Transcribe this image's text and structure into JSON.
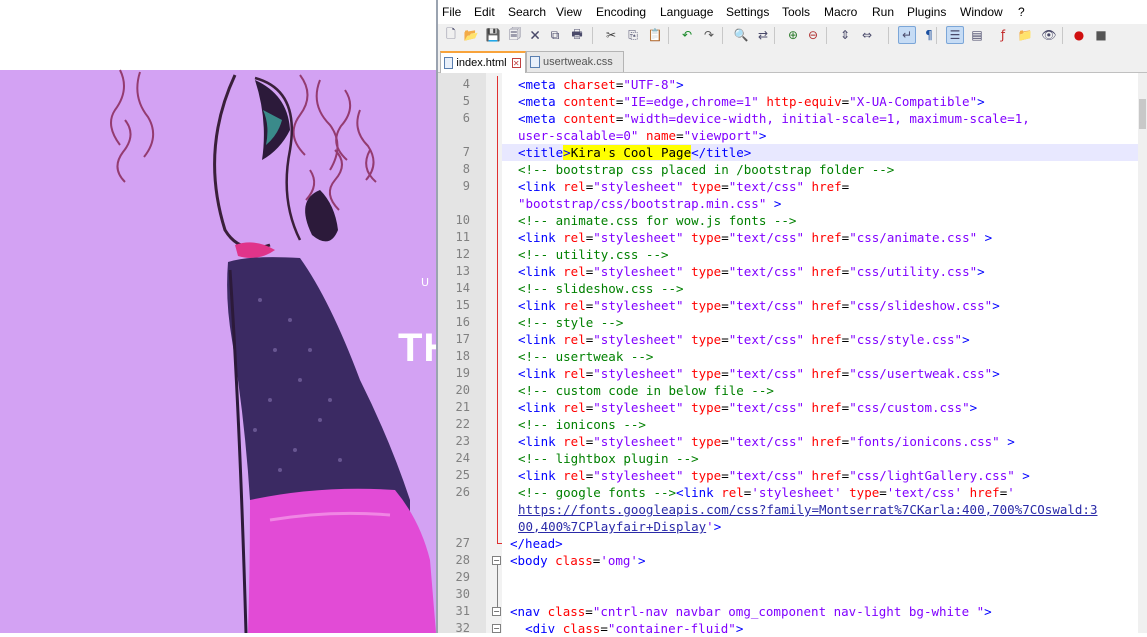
{
  "preview": {
    "hero_small": "U",
    "hero_big": "TH"
  },
  "menu": [
    "File",
    "Edit",
    "Search",
    "View",
    "Encoding",
    "Language",
    "Settings",
    "Tools",
    "Macro",
    "Run",
    "Plugins",
    "Window",
    "?"
  ],
  "toolbar_icons": [
    "new-file-icon",
    "open-file-icon",
    "save-icon",
    "save-all-icon",
    "close-icon",
    "close-all-icon",
    "print-icon",
    "cut-icon",
    "copy-icon",
    "paste-icon",
    "undo-icon",
    "redo-icon",
    "find-icon",
    "replace-icon",
    "zoom-in-icon",
    "zoom-out-icon",
    "sync-vertical-icon",
    "sync-horizontal-icon",
    "word-wrap-icon",
    "show-all-chars-icon",
    "indent-guide-icon",
    "doc-map-icon",
    "function-list-icon",
    "folder-workspace-icon",
    "monitor-icon",
    "record-macro-icon",
    "stop-record-icon"
  ],
  "tabs": [
    {
      "label": "index.html",
      "active": true
    },
    {
      "label": "usertweak.css",
      "active": false
    }
  ],
  "colors": {
    "accent_tab": "#f8a33b",
    "tag": "#0000ff",
    "attribute": "#ff0000",
    "value": "#8000ff",
    "comment": "#008000",
    "highlight": "#ffff00"
  },
  "code": {
    "lines": [
      {
        "n": "4",
        "segs": [
          [
            "tag",
            "<meta "
          ],
          [
            "attr",
            "charset"
          ],
          [
            "txt",
            "="
          ],
          [
            "val",
            "\"UTF-8\""
          ],
          [
            "tag",
            ">"
          ]
        ]
      },
      {
        "n": "5",
        "segs": [
          [
            "tag",
            "<meta "
          ],
          [
            "attr",
            "content"
          ],
          [
            "txt",
            "="
          ],
          [
            "val",
            "\"IE=edge,chrome=1\""
          ],
          [
            "txt",
            " "
          ],
          [
            "attr",
            "http-equiv"
          ],
          [
            "txt",
            "="
          ],
          [
            "val",
            "\"X-UA-Compatible\""
          ],
          [
            "tag",
            ">"
          ]
        ]
      },
      {
        "n": "6",
        "segs": [
          [
            "tag",
            "<meta "
          ],
          [
            "attr",
            "content"
          ],
          [
            "txt",
            "="
          ],
          [
            "val",
            "\"width=device-width, initial-scale=1, maximum-scale=1,"
          ]
        ]
      },
      {
        "n": "",
        "segs": [
          [
            "val",
            "user-scalable=0\""
          ],
          [
            "txt",
            " "
          ],
          [
            "attr",
            "name"
          ],
          [
            "txt",
            "="
          ],
          [
            "val",
            "\"viewport\""
          ],
          [
            "tag",
            ">"
          ]
        ]
      },
      {
        "n": "7",
        "current": true,
        "segs": [
          [
            "tag",
            "<title"
          ],
          [
            "tag_hl",
            ">Kira's Cool Page"
          ],
          [
            "tag",
            "</title>"
          ]
        ]
      },
      {
        "n": "8",
        "segs": [
          [
            "cmt",
            "<!-- bootstrap css placed in /bootstrap folder -->"
          ]
        ]
      },
      {
        "n": "9",
        "segs": [
          [
            "tag",
            "<link "
          ],
          [
            "attr",
            "rel"
          ],
          [
            "txt",
            "="
          ],
          [
            "val",
            "\"stylesheet\""
          ],
          [
            "txt",
            " "
          ],
          [
            "attr",
            "type"
          ],
          [
            "txt",
            "="
          ],
          [
            "val",
            "\"text/css\""
          ],
          [
            "txt",
            " "
          ],
          [
            "attr",
            "href"
          ],
          [
            "txt",
            "="
          ]
        ]
      },
      {
        "n": "",
        "segs": [
          [
            "val",
            "\"bootstrap/css/bootstrap.min.css\""
          ],
          [
            "txt",
            " "
          ],
          [
            "tag",
            ">"
          ]
        ]
      },
      {
        "n": "10",
        "segs": [
          [
            "cmt",
            "<!-- animate.css for wow.js fonts -->"
          ]
        ]
      },
      {
        "n": "11",
        "segs": [
          [
            "tag",
            "<link "
          ],
          [
            "attr",
            "rel"
          ],
          [
            "txt",
            "="
          ],
          [
            "val",
            "\"stylesheet\""
          ],
          [
            "txt",
            " "
          ],
          [
            "attr",
            "type"
          ],
          [
            "txt",
            "="
          ],
          [
            "val",
            "\"text/css\""
          ],
          [
            "txt",
            " "
          ],
          [
            "attr",
            "href"
          ],
          [
            "txt",
            "="
          ],
          [
            "val",
            "\"css/animate.css\""
          ],
          [
            "txt",
            " "
          ],
          [
            "tag",
            ">"
          ]
        ]
      },
      {
        "n": "12",
        "segs": [
          [
            "cmt",
            "<!-- utility.css -->"
          ]
        ]
      },
      {
        "n": "13",
        "segs": [
          [
            "tag",
            "<link "
          ],
          [
            "attr",
            "rel"
          ],
          [
            "txt",
            "="
          ],
          [
            "val",
            "\"stylesheet\""
          ],
          [
            "txt",
            " "
          ],
          [
            "attr",
            "type"
          ],
          [
            "txt",
            "="
          ],
          [
            "val",
            "\"text/css\""
          ],
          [
            "txt",
            " "
          ],
          [
            "attr",
            "href"
          ],
          [
            "txt",
            "="
          ],
          [
            "val",
            "\"css/utility.css\""
          ],
          [
            "tag",
            ">"
          ]
        ]
      },
      {
        "n": "14",
        "segs": [
          [
            "cmt",
            "<!-- slideshow.css -->"
          ]
        ]
      },
      {
        "n": "15",
        "segs": [
          [
            "tag",
            "<link "
          ],
          [
            "attr",
            "rel"
          ],
          [
            "txt",
            "="
          ],
          [
            "val",
            "\"stylesheet\""
          ],
          [
            "txt",
            " "
          ],
          [
            "attr",
            "type"
          ],
          [
            "txt",
            "="
          ],
          [
            "val",
            "\"text/css\""
          ],
          [
            "txt",
            " "
          ],
          [
            "attr",
            "href"
          ],
          [
            "txt",
            "="
          ],
          [
            "val",
            "\"css/slideshow.css\""
          ],
          [
            "tag",
            ">"
          ]
        ]
      },
      {
        "n": "16",
        "segs": [
          [
            "cmt",
            "<!-- style -->"
          ]
        ]
      },
      {
        "n": "17",
        "segs": [
          [
            "tag",
            "<link "
          ],
          [
            "attr",
            "rel"
          ],
          [
            "txt",
            "="
          ],
          [
            "val",
            "\"stylesheet\""
          ],
          [
            "txt",
            " "
          ],
          [
            "attr",
            "type"
          ],
          [
            "txt",
            "="
          ],
          [
            "val",
            "\"text/css\""
          ],
          [
            "txt",
            " "
          ],
          [
            "attr",
            "href"
          ],
          [
            "txt",
            "="
          ],
          [
            "val",
            "\"css/style.css\""
          ],
          [
            "tag",
            ">"
          ]
        ]
      },
      {
        "n": "18",
        "segs": [
          [
            "cmt",
            "<!-- usertweak -->"
          ]
        ]
      },
      {
        "n": "19",
        "segs": [
          [
            "tag",
            "<link "
          ],
          [
            "attr",
            "rel"
          ],
          [
            "txt",
            "="
          ],
          [
            "val",
            "\"stylesheet\""
          ],
          [
            "txt",
            " "
          ],
          [
            "attr",
            "type"
          ],
          [
            "txt",
            "="
          ],
          [
            "val",
            "\"text/css\""
          ],
          [
            "txt",
            " "
          ],
          [
            "attr",
            "href"
          ],
          [
            "txt",
            "="
          ],
          [
            "val",
            "\"css/usertweak.css\""
          ],
          [
            "tag",
            ">"
          ]
        ]
      },
      {
        "n": "20",
        "segs": [
          [
            "cmt",
            "<!-- custom code in below file -->"
          ]
        ]
      },
      {
        "n": "21",
        "segs": [
          [
            "tag",
            "<link "
          ],
          [
            "attr",
            "rel"
          ],
          [
            "txt",
            "="
          ],
          [
            "val",
            "\"stylesheet\""
          ],
          [
            "txt",
            " "
          ],
          [
            "attr",
            "type"
          ],
          [
            "txt",
            "="
          ],
          [
            "val",
            "\"text/css\""
          ],
          [
            "txt",
            " "
          ],
          [
            "attr",
            "href"
          ],
          [
            "txt",
            "="
          ],
          [
            "val",
            "\"css/custom.css\""
          ],
          [
            "tag",
            ">"
          ]
        ]
      },
      {
        "n": "22",
        "segs": [
          [
            "cmt",
            "<!-- ionicons -->"
          ]
        ]
      },
      {
        "n": "23",
        "segs": [
          [
            "tag",
            "<link "
          ],
          [
            "attr",
            "rel"
          ],
          [
            "txt",
            "="
          ],
          [
            "val",
            "\"stylesheet\""
          ],
          [
            "txt",
            " "
          ],
          [
            "attr",
            "type"
          ],
          [
            "txt",
            "="
          ],
          [
            "val",
            "\"text/css\""
          ],
          [
            "txt",
            " "
          ],
          [
            "attr",
            "href"
          ],
          [
            "txt",
            "="
          ],
          [
            "val",
            "\"fonts/ionicons.css\""
          ],
          [
            "txt",
            " "
          ],
          [
            "tag",
            ">"
          ]
        ]
      },
      {
        "n": "24",
        "segs": [
          [
            "cmt",
            "<!-- lightbox plugin -->"
          ]
        ]
      },
      {
        "n": "25",
        "segs": [
          [
            "tag",
            "<link "
          ],
          [
            "attr",
            "rel"
          ],
          [
            "txt",
            "="
          ],
          [
            "val",
            "\"stylesheet\""
          ],
          [
            "txt",
            " "
          ],
          [
            "attr",
            "type"
          ],
          [
            "txt",
            "="
          ],
          [
            "val",
            "\"text/css\""
          ],
          [
            "txt",
            " "
          ],
          [
            "attr",
            "href"
          ],
          [
            "txt",
            "="
          ],
          [
            "val",
            "\"css/lightGallery.css\""
          ],
          [
            "txt",
            " "
          ],
          [
            "tag",
            ">"
          ]
        ]
      },
      {
        "n": "26",
        "segs": [
          [
            "cmt",
            "<!-- google fonts -->"
          ],
          [
            "tag",
            "<link "
          ],
          [
            "attr",
            "rel"
          ],
          [
            "txt",
            "="
          ],
          [
            "val",
            "'stylesheet'"
          ],
          [
            "txt",
            " "
          ],
          [
            "attr",
            "type"
          ],
          [
            "txt",
            "="
          ],
          [
            "val",
            "'text/css'"
          ],
          [
            "txt",
            " "
          ],
          [
            "attr",
            "href"
          ],
          [
            "txt",
            "="
          ],
          [
            "val",
            "'"
          ]
        ]
      },
      {
        "n": "",
        "segs": [
          [
            "url",
            "https://fonts.googleapis.com/css?family=Montserrat%7CKarla:400,700%7COswald:3"
          ]
        ]
      },
      {
        "n": "",
        "segs": [
          [
            "url",
            "00,400%7CPlayfair+Display"
          ],
          [
            "val",
            "'"
          ],
          [
            "tag",
            ">"
          ]
        ]
      },
      {
        "n": "27",
        "segs": [
          [
            "tag",
            "</head>"
          ]
        ]
      },
      {
        "n": "28",
        "segs": [
          [
            "tag",
            "<body "
          ],
          [
            "attr",
            "class"
          ],
          [
            "txt",
            "="
          ],
          [
            "val",
            "'omg'"
          ],
          [
            "tag",
            ">"
          ]
        ]
      },
      {
        "n": "29",
        "segs": []
      },
      {
        "n": "30",
        "segs": []
      },
      {
        "n": "31",
        "segs": [
          [
            "tag",
            "<nav "
          ],
          [
            "attr",
            "class"
          ],
          [
            "txt",
            "="
          ],
          [
            "val",
            "\"cntrl-nav navbar omg_component nav-light bg-white \""
          ],
          [
            "tag",
            ">"
          ]
        ]
      },
      {
        "n": "32",
        "segs": [
          [
            "txt",
            "  "
          ],
          [
            "tag",
            "<div "
          ],
          [
            "attr",
            "class"
          ],
          [
            "txt",
            "="
          ],
          [
            "val",
            "\"container-fluid\""
          ],
          [
            "tag",
            ">"
          ]
        ]
      }
    ]
  }
}
